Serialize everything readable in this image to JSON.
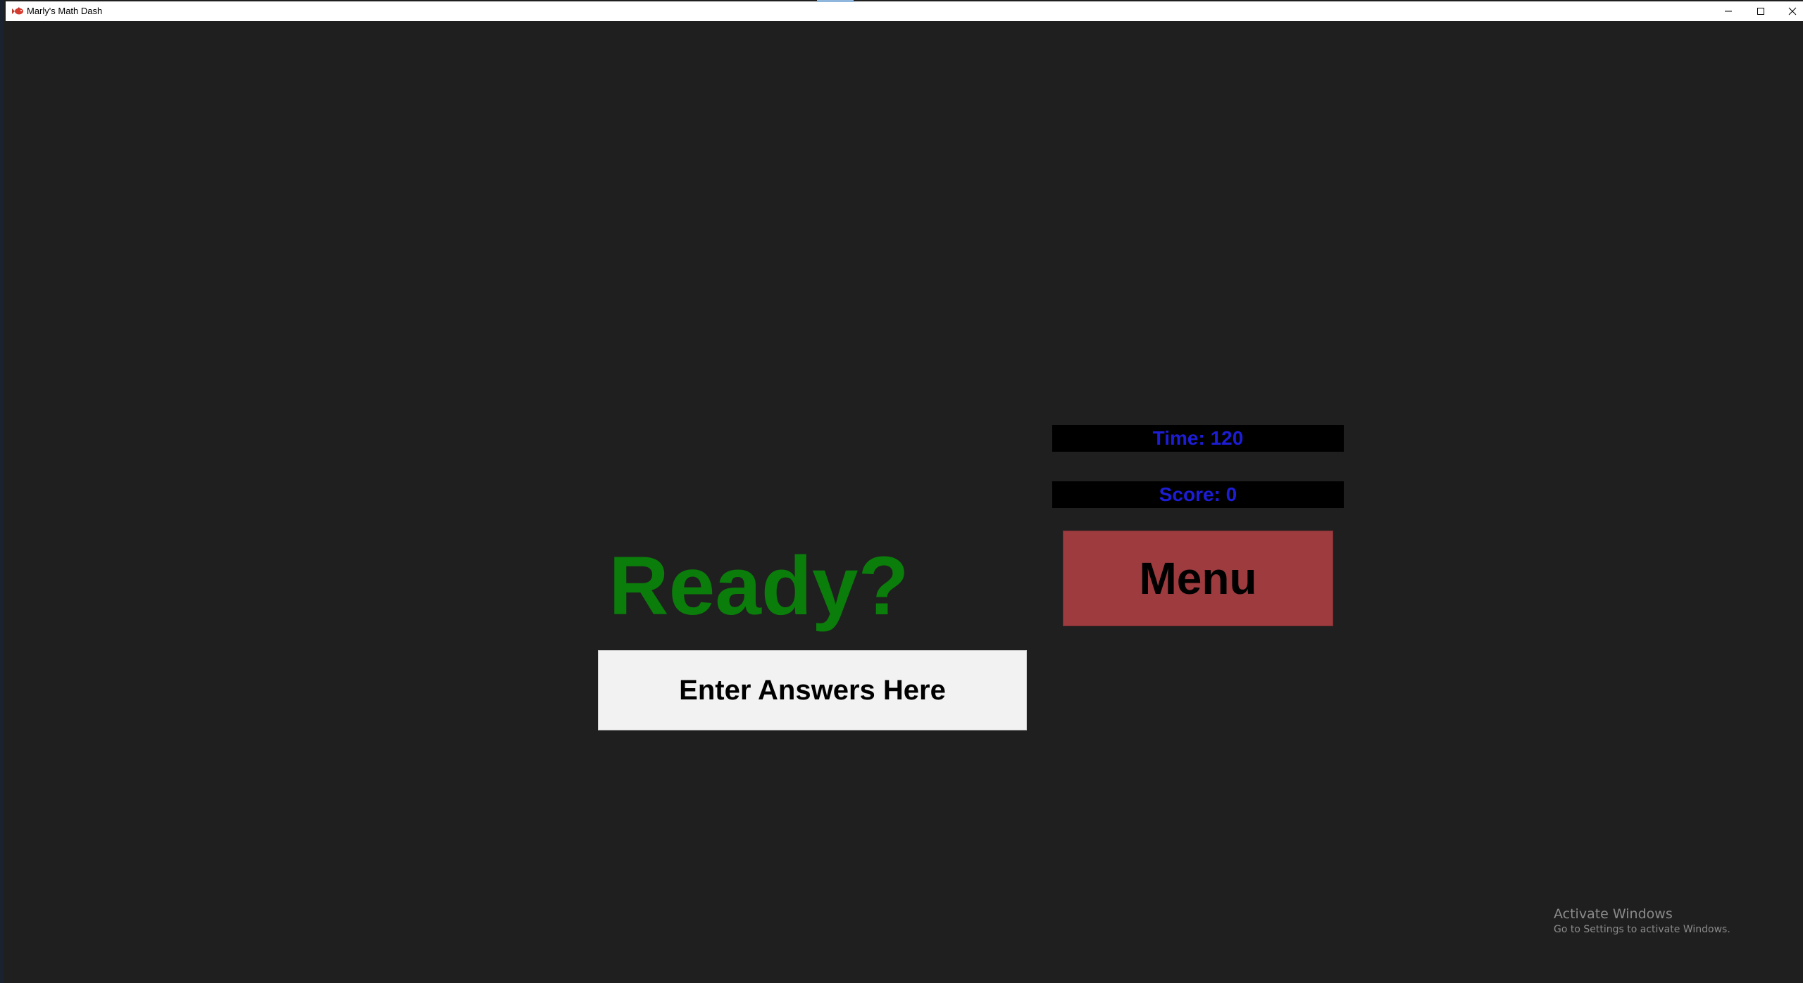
{
  "window": {
    "title": "Marly's Math Dash",
    "icon": "fish-icon"
  },
  "hud": {
    "time_label": "Time: 120",
    "score_label": "Score: 0"
  },
  "menu_button": {
    "label": "Menu"
  },
  "status": {
    "ready_text": "Ready?"
  },
  "answer_field": {
    "placeholder": "Enter Answers Here"
  },
  "watermark": {
    "title": "Activate Windows",
    "subtitle": "Go to Settings to activate Windows."
  },
  "colors": {
    "background": "#1f1f1f",
    "ready_text": "#0a7d0a",
    "hud_text": "#1d1dd6",
    "hud_background": "#000000",
    "menu_button": "#9d3b3f",
    "answer_field": "#f2f2f2"
  }
}
